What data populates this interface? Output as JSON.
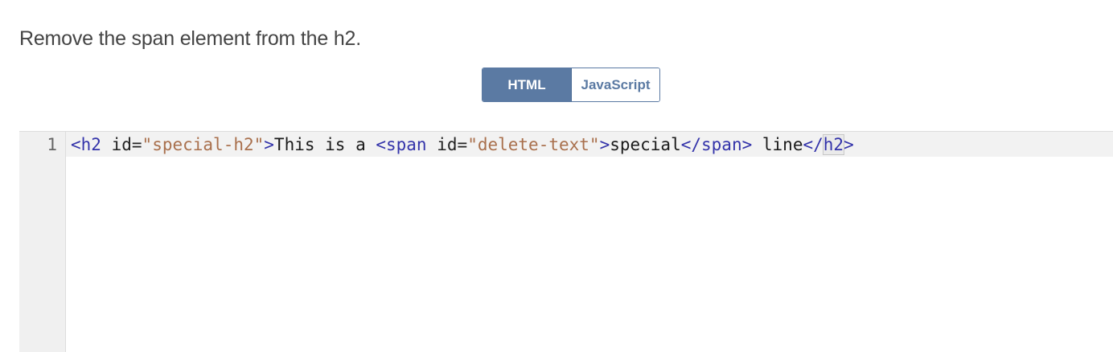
{
  "instruction": "Remove the span element from the h2.",
  "tabs": [
    {
      "label": "HTML",
      "active": true
    },
    {
      "label": "JavaScript",
      "active": false
    }
  ],
  "editor": {
    "line_numbers": [
      "1"
    ],
    "code": {
      "open_h2": "<h2",
      "space1": " ",
      "attr_id1": "id",
      "eq1": "=",
      "val_id1": "\"special-h2\"",
      "close_h2_open": ">",
      "text1": "This is a ",
      "open_span": "<span",
      "space2": " ",
      "attr_id2": "id",
      "eq2": "=",
      "val_id2": "\"delete-text\"",
      "close_span_open": ">",
      "text2": "special",
      "end_span": "</span>",
      "text3": " line",
      "end_h2_lt": "</",
      "end_h2_name": "h2",
      "end_h2_gt": ">"
    }
  },
  "colors": {
    "tab_accent": "#5b7aa3",
    "tag": "#3333aa",
    "string": "#a9704d",
    "gutter": "#f0f0f0"
  }
}
